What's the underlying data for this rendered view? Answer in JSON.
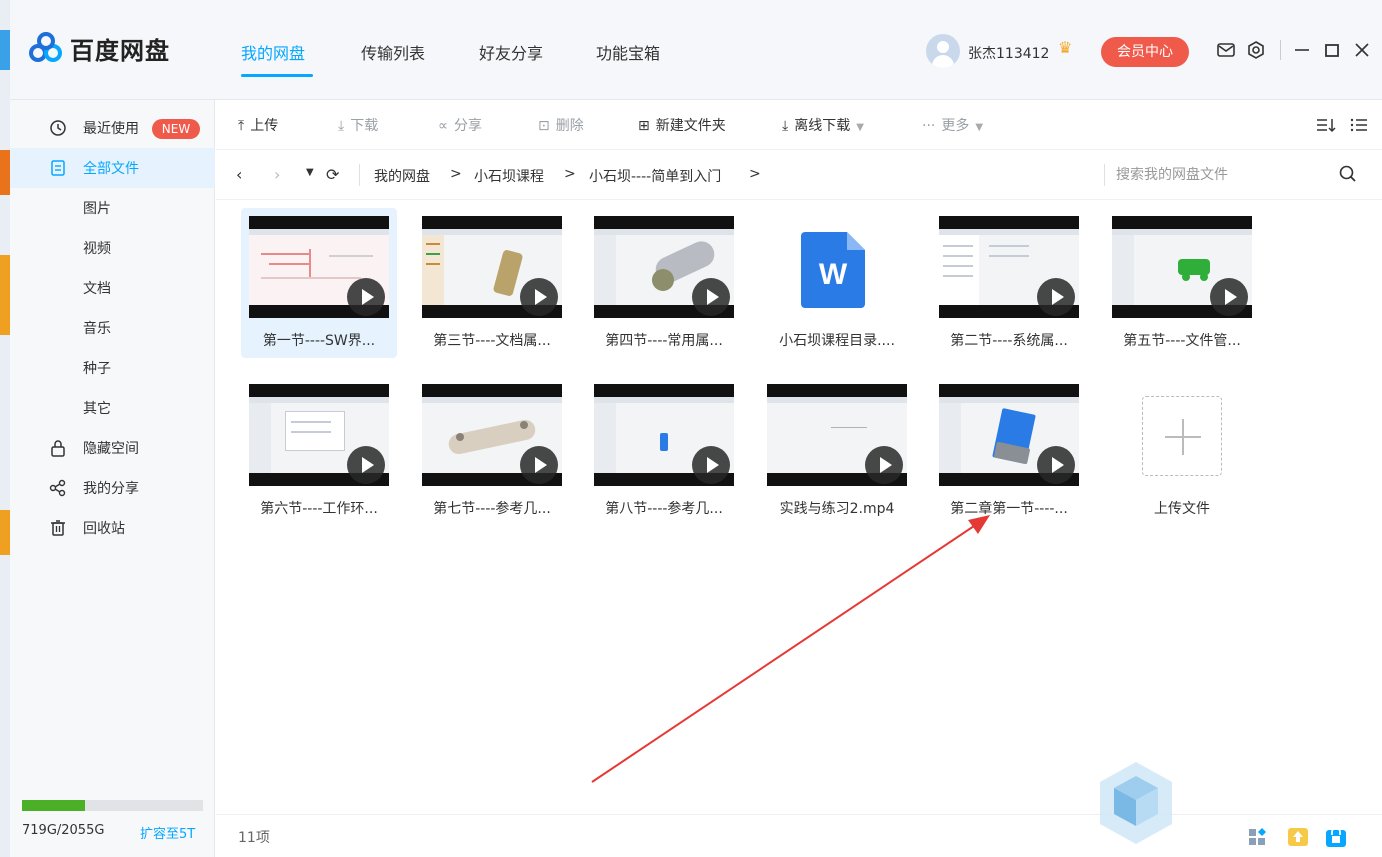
{
  "app": {
    "name": "百度网盘"
  },
  "nav": {
    "tabs": [
      {
        "label": "我的网盘",
        "active": true
      },
      {
        "label": "传输列表",
        "active": false
      },
      {
        "label": "好友分享",
        "active": false
      },
      {
        "label": "功能宝箱",
        "active": false
      }
    ]
  },
  "user": {
    "name": "张杰113412",
    "vip_label": "会员中心"
  },
  "colors": {
    "accent": "#06a7ff",
    "vip": "#f05a4b",
    "quota": "#4caf28",
    "annotation_arrow": "#e53935"
  },
  "sidebar": {
    "items": [
      {
        "label": "最近使用",
        "icon": "clock-icon",
        "badge": "NEW"
      },
      {
        "label": "全部文件",
        "icon": "file-list-icon",
        "active": true
      },
      {
        "label": "图片"
      },
      {
        "label": "视频"
      },
      {
        "label": "文档"
      },
      {
        "label": "音乐"
      },
      {
        "label": "种子"
      },
      {
        "label": "其它"
      },
      {
        "label": "隐藏空间",
        "icon": "lock-icon"
      },
      {
        "label": "我的分享",
        "icon": "share-icon"
      },
      {
        "label": "回收站",
        "icon": "trash-icon"
      }
    ],
    "quota": {
      "text": "719G/2055G",
      "used_fraction": 0.35,
      "expand": "扩容至5T"
    }
  },
  "toolbar": {
    "upload": "上传",
    "download": "下载",
    "share": "分享",
    "delete": "删除",
    "new_folder": "新建文件夹",
    "offline_download": "离线下载",
    "more": "更多"
  },
  "path": {
    "crumbs": [
      "我的网盘",
      "小石坝课程",
      "小石坝----简单到入门"
    ],
    "search_placeholder": "搜索我的网盘文件"
  },
  "files": [
    {
      "name": "第一节----SW界...",
      "type": "video",
      "selected": true
    },
    {
      "name": "第三节----文档属...",
      "type": "video"
    },
    {
      "name": "第四节----常用属...",
      "type": "video"
    },
    {
      "name": "小石坝课程目录....",
      "type": "word",
      "icon_letter": "W"
    },
    {
      "name": "第二节----系统属...",
      "type": "video"
    },
    {
      "name": "第五节----文件管...",
      "type": "video"
    },
    {
      "name": "第六节----工作环...",
      "type": "video"
    },
    {
      "name": "第七节----参考几...",
      "type": "video"
    },
    {
      "name": "第八节----参考几...",
      "type": "video"
    },
    {
      "name": "实践与练习2.mp4",
      "type": "video"
    },
    {
      "name": "第二章第一节----...",
      "type": "video"
    },
    {
      "name": "上传文件",
      "type": "upload"
    }
  ],
  "status": {
    "count": "11项"
  }
}
